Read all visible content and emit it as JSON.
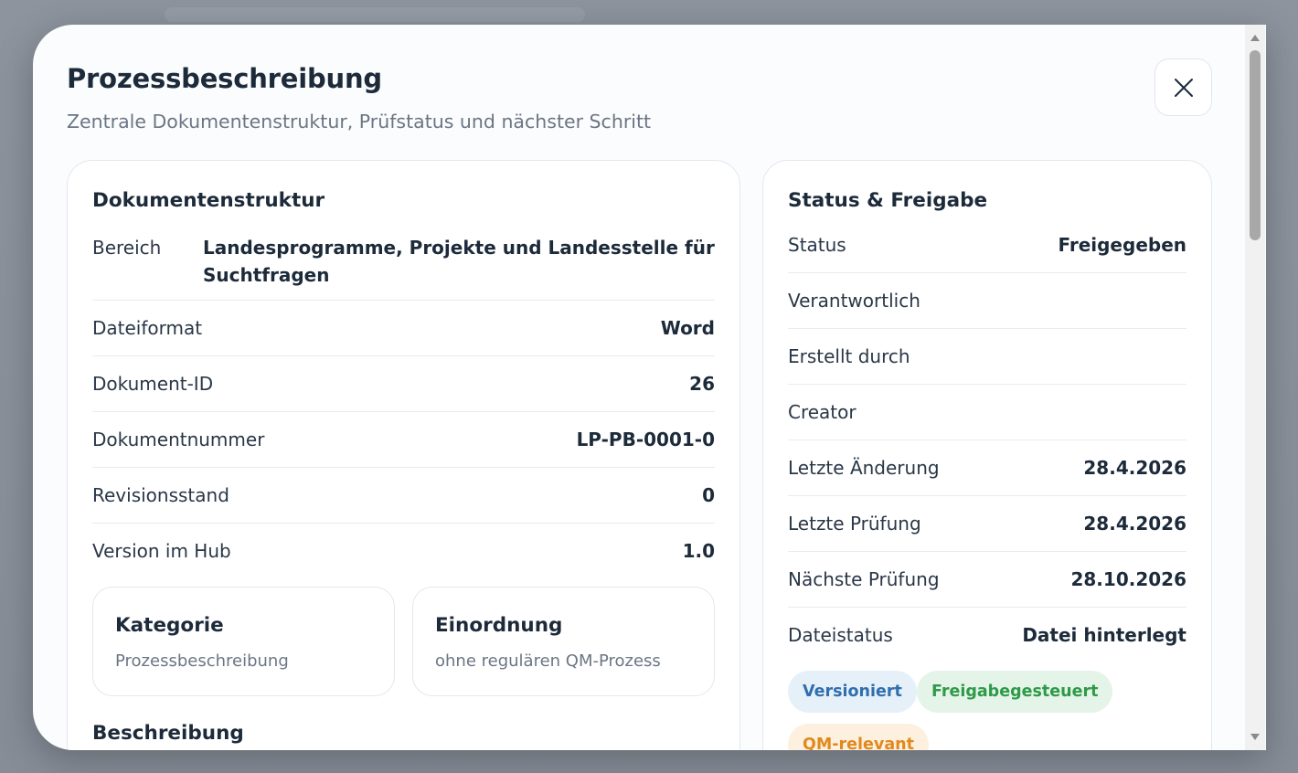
{
  "modal": {
    "title": "Prozessbeschreibung",
    "subtitle": "Zentrale Dokumentenstruktur, Prüfstatus und nächster Schritt"
  },
  "structure": {
    "title": "Dokumentenstruktur",
    "rows": [
      {
        "label": "Bereich",
        "value": "Landesprogramme, Projekte und Landesstelle für Suchtfragen"
      },
      {
        "label": "Dateiformat",
        "value": "Word"
      },
      {
        "label": "Dokument-ID",
        "value": "26"
      },
      {
        "label": "Dokumentnummer",
        "value": "LP-PB-0001-0"
      },
      {
        "label": "Revisionsstand",
        "value": "0"
      },
      {
        "label": "Version im Hub",
        "value": "1.0"
      }
    ],
    "kategorie": {
      "title": "Kategorie",
      "value": "Prozessbeschreibung"
    },
    "einordnung": {
      "title": "Einordnung",
      "value": "ohne regulären QM-Prozess"
    },
    "beschreibung_title": "Beschreibung"
  },
  "status": {
    "title": "Status & Freigabe",
    "rows": [
      {
        "label": "Status",
        "value": "Freigegeben"
      },
      {
        "label": "Verantwortlich",
        "value": ""
      },
      {
        "label": "Erstellt durch",
        "value": ""
      },
      {
        "label": "Creator",
        "value": ""
      },
      {
        "label": "Letzte Änderung",
        "value": "28.4.2026"
      },
      {
        "label": "Letzte Prüfung",
        "value": "28.4.2026"
      },
      {
        "label": "Nächste Prüfung",
        "value": "28.10.2026"
      },
      {
        "label": "Dateistatus",
        "value": "Datei hinterlegt"
      }
    ],
    "chips": [
      {
        "label": "Versioniert",
        "color": "#2f6fae",
        "bg": "#e6f0f9"
      },
      {
        "label": "Freigabegesteuert",
        "color": "#2e9a48",
        "bg": "#e5f4e8"
      },
      {
        "label": "QM-relevant",
        "color": "#e08a1e",
        "bg": "#fdf0df"
      }
    ]
  },
  "colors": {
    "text": "#1c2a3a",
    "muted": "#6b7684",
    "border": "#e3e7ec"
  }
}
